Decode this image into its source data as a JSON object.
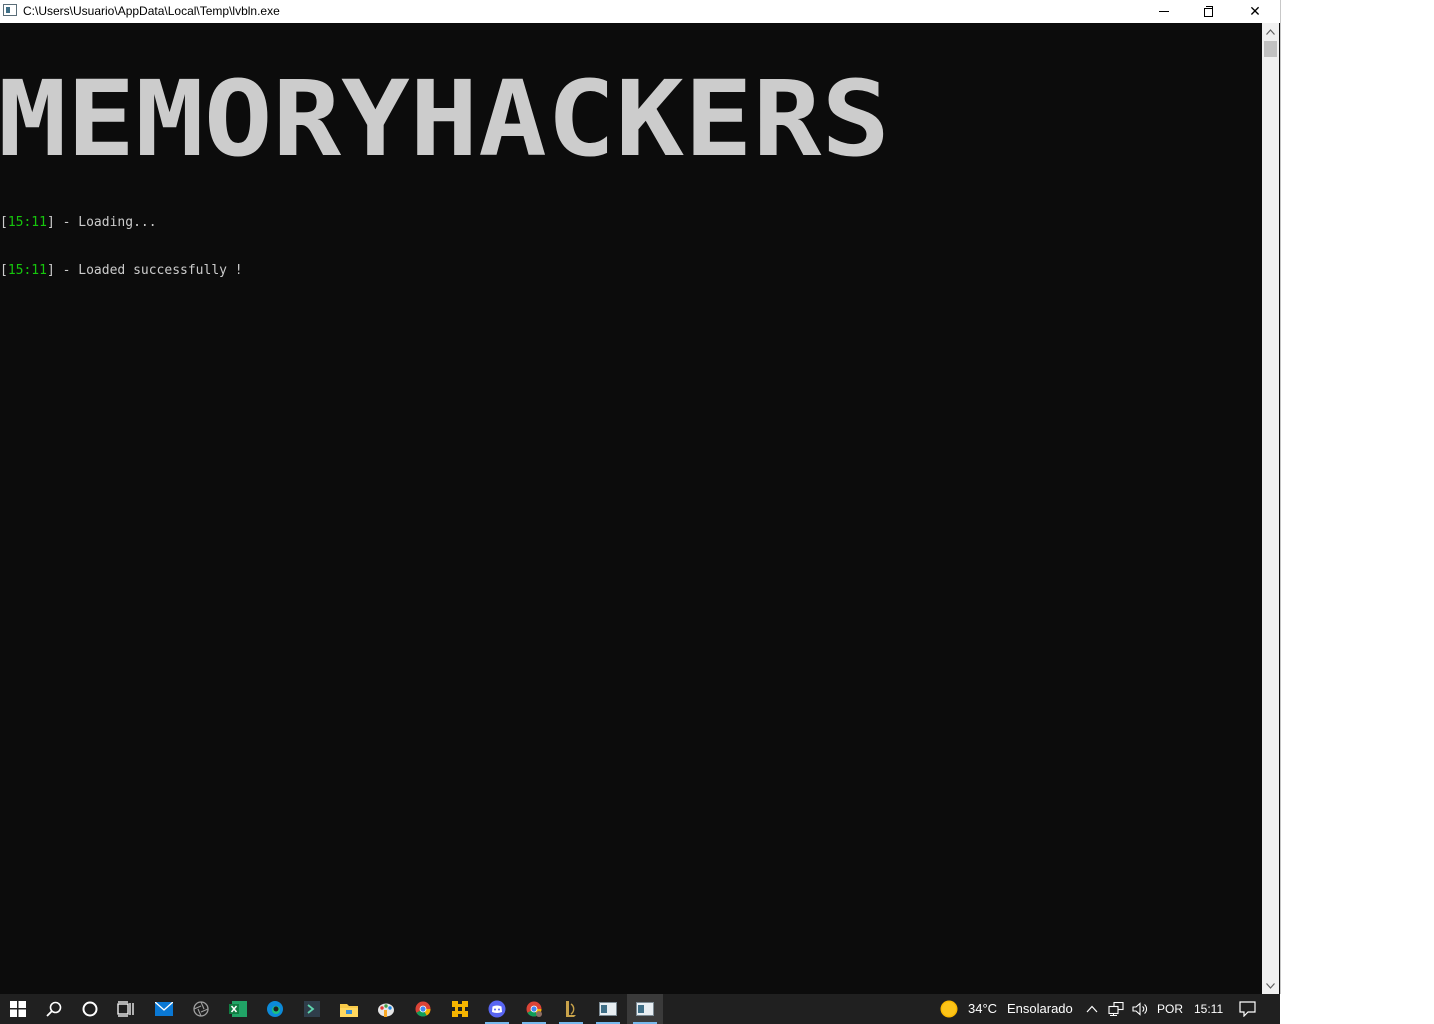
{
  "window": {
    "title": "C:\\Users\\Usuario\\AppData\\Local\\Temp\\lvbln.exe",
    "minimize_label": "—",
    "close_label": "✕"
  },
  "console": {
    "banner": "MEMORYHACKERS",
    "banner_color": "#cccccc",
    "background": "#0c0c0c",
    "timestamp_color": "#16c60c",
    "lines": [
      {
        "open": "[",
        "time": "15:11",
        "close": "]",
        "message": " - Loading..."
      },
      {
        "open": "[",
        "time": "15:11",
        "close": "]",
        "message": " - Loaded successfully !"
      }
    ]
  },
  "scrollbar": {
    "up_icon": "scroll-up-arrow-icon",
    "down_icon": "scroll-down-arrow-icon"
  },
  "taskbar": {
    "items": [
      {
        "icon": "windows-start-icon"
      },
      {
        "icon": "search-icon"
      },
      {
        "icon": "cortana-circle-icon"
      },
      {
        "icon": "task-view-icon"
      },
      {
        "icon": "mail-icon"
      },
      {
        "icon": "aperture-app-icon"
      },
      {
        "icon": "excel-icon"
      },
      {
        "icon": "edge-icon"
      },
      {
        "icon": "terminal-app-icon"
      },
      {
        "icon": "file-explorer-icon"
      },
      {
        "icon": "paint-app-icon"
      },
      {
        "icon": "chrome-icon"
      },
      {
        "icon": "yellow-tool-icon"
      },
      {
        "icon": "discord-icon"
      },
      {
        "icon": "chrome-profile-icon"
      },
      {
        "icon": "league-of-legends-icon"
      },
      {
        "icon": "console-window-icon"
      },
      {
        "icon": "console-window-active-icon"
      }
    ],
    "weather": {
      "icon": "sun-icon",
      "temperature": "34°C",
      "condition": "Ensolarado"
    },
    "tray": {
      "chevron_icon": "chevron-up-icon",
      "network_icon": "network-icon",
      "volume_icon": "volume-icon",
      "language": "POR",
      "clock": "15:11",
      "notification_icon": "notification-icon"
    }
  }
}
